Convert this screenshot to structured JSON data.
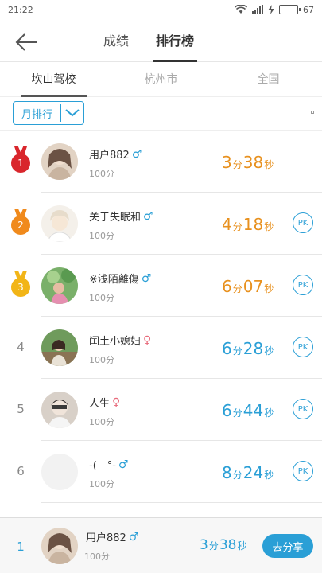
{
  "status": {
    "time": "21:22",
    "battery": "67"
  },
  "header": {
    "tabs": [
      {
        "label": "成绩"
      },
      {
        "label": "排行榜"
      }
    ],
    "active": 1
  },
  "region_tabs": [
    {
      "label": "坎山驾校"
    },
    {
      "label": "杭州市"
    },
    {
      "label": "全国"
    }
  ],
  "filter": {
    "selected": "月排行"
  },
  "time_units": {
    "min": "分",
    "sec": "秒"
  },
  "leaderboard": [
    {
      "rank": "1",
      "name": "用户882",
      "gender": "male",
      "gender_symbol": "♂",
      "score": "100分",
      "min": "3",
      "sec": "38",
      "color": "#e8911f",
      "medal": "#d9262c",
      "pk": ""
    },
    {
      "rank": "2",
      "name": "关于失眠和",
      "gender": "male",
      "gender_symbol": "♂",
      "score": "100分",
      "min": "4",
      "sec": "18",
      "color": "#e8911f",
      "medal": "#f08a1c",
      "pk": "PK"
    },
    {
      "rank": "3",
      "name": "※浅陌離傷",
      "gender": "male",
      "gender_symbol": "♂",
      "score": "100分",
      "min": "6",
      "sec": "07",
      "color": "#e8911f",
      "medal": "#f2b517",
      "pk": "PK"
    },
    {
      "rank": "4",
      "name": "闰土小媳妇",
      "gender": "female",
      "gender_symbol": "♀",
      "score": "100分",
      "min": "6",
      "sec": "28",
      "color": "#2a9fd6",
      "medal": "",
      "pk": "PK"
    },
    {
      "rank": "5",
      "name": "人生",
      "gender": "female",
      "gender_symbol": "♀",
      "score": "100分",
      "min": "6",
      "sec": "44",
      "color": "#2a9fd6",
      "medal": "",
      "pk": "PK"
    },
    {
      "rank": "6",
      "name": "-(　°-",
      "gender": "male",
      "gender_symbol": "♂",
      "score": "100分",
      "min": "8",
      "sec": "24",
      "color": "#2a9fd6",
      "medal": "",
      "pk": "PK"
    }
  ],
  "me": {
    "rank": "1",
    "name": "用户882",
    "gender_symbol": "♂",
    "score": "100分",
    "min": "3",
    "sec": "38",
    "share_label": "去分享"
  },
  "colors": {
    "accent": "#2a9fd6",
    "top3": "#e8911f",
    "female": "#e86b7c"
  }
}
